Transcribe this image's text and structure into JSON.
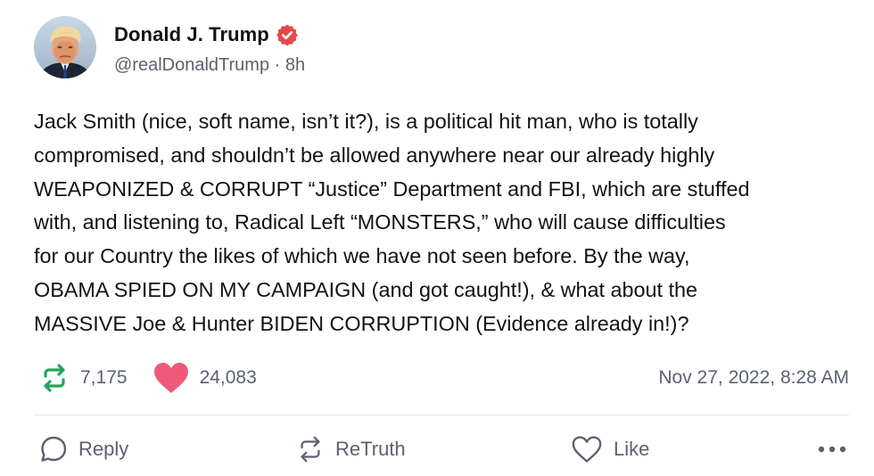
{
  "author": {
    "display_name": "Donald J. Trump",
    "handle": "@realDonaldTrump",
    "separator": "·",
    "time_ago": "8h",
    "verified_color": "#e5484d"
  },
  "post": {
    "text": "Jack Smith (nice, soft name, isn’t it?), is a political hit man, who is totally\ncompromised, and shouldn’t be allowed anywhere near our already highly\nWEAPONIZED & CORRUPT “Justice” Department and FBI, which are stuffed\nwith, and listening to, Radical Left “MONSTERS,” who will  cause difficulties\nfor our Country the likes of which we have not seen before. By the way,\nOBAMA SPIED ON MY CAMPAIGN (and got caught!), & what about the\nMASSIVE Joe & Hunter BIDEN CORRUPTION (Evidence already in!)?"
  },
  "stats": {
    "retruths": "7,175",
    "likes": "24,083",
    "timestamp": "Nov 27, 2022, 8:28 AM",
    "retruth_color": "#22a35a",
    "like_color": "#f0587a"
  },
  "actions": {
    "reply_label": "Reply",
    "retruth_label": "ReTruth",
    "like_label": "Like",
    "more_icon": "more-horizontal-icon"
  }
}
